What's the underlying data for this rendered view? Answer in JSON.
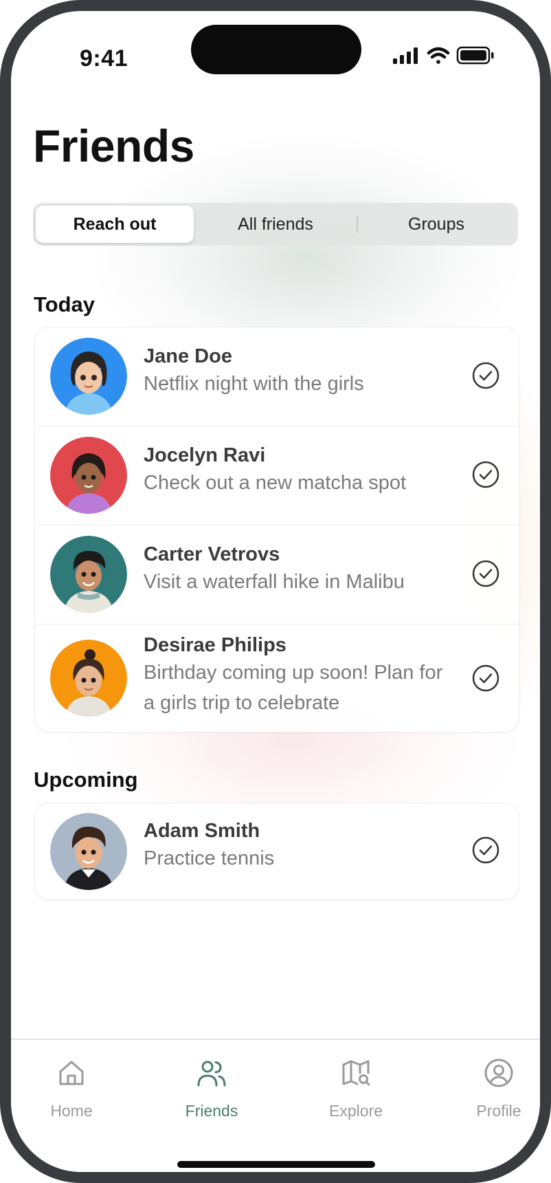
{
  "status_bar": {
    "time": "9:41"
  },
  "page": {
    "title": "Friends"
  },
  "segments": [
    {
      "label": "Reach out",
      "active": true
    },
    {
      "label": "All friends",
      "active": false
    },
    {
      "label": "Groups",
      "active": false
    }
  ],
  "sections": {
    "today": {
      "title": "Today",
      "items": [
        {
          "name": "Jane Doe",
          "desc": "Netflix night with the girls",
          "avatar_color": "#2e8ff0"
        },
        {
          "name": "Jocelyn Ravi",
          "desc": "Check out a new matcha spot",
          "avatar_color": "#e0484e"
        },
        {
          "name": "Carter Vetrovs",
          "desc": "Visit a waterfall hike in Malibu",
          "avatar_color": "#2f7a79"
        },
        {
          "name": "Desirae Philips",
          "desc": "Birthday coming up soon! Plan for a girls trip to celebrate",
          "avatar_color": "#f5960c"
        }
      ]
    },
    "upcoming": {
      "title": "Upcoming",
      "items": [
        {
          "name": "Adam Smith",
          "desc": "Practice tennis",
          "avatar_color": "#a9b8c8"
        }
      ]
    }
  },
  "tabbar": {
    "items": [
      {
        "label": "Home",
        "icon": "home-icon",
        "active": false
      },
      {
        "label": "Friends",
        "icon": "users-icon",
        "active": true
      },
      {
        "label": "Explore",
        "icon": "map-search-icon",
        "active": false
      },
      {
        "label": "Profile",
        "icon": "user-circle-icon",
        "active": false
      }
    ]
  },
  "colors": {
    "accent": "#4d7d6f",
    "inactive": "#9a9a9a",
    "frame": "#3a3b3f"
  }
}
